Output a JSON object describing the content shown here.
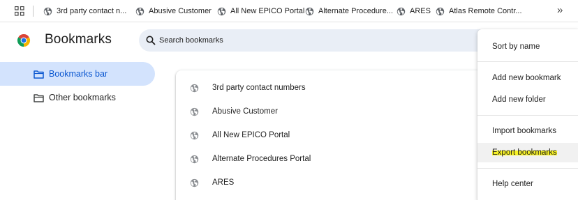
{
  "bookmarks_bar": {
    "items": [
      {
        "label": "3rd party contact n...",
        "icon": "globe-icon"
      },
      {
        "label": "Abusive Customer",
        "icon": "globe-icon"
      },
      {
        "label": "All New EPICO Portal",
        "icon": "globe-icon"
      },
      {
        "label": "Alternate Procedure...",
        "icon": "globe-icon"
      },
      {
        "label": "ARES",
        "icon": "globe-icon"
      },
      {
        "label": "Atlas Remote Contr...",
        "icon": "globe-icon"
      }
    ],
    "overflow_glyph": "»"
  },
  "header": {
    "title": "Bookmarks",
    "search_placeholder": "Search bookmarks"
  },
  "sidebar": {
    "items": [
      {
        "label": "Bookmarks bar",
        "active": true
      },
      {
        "label": "Other bookmarks",
        "active": false
      }
    ]
  },
  "list": {
    "rows": [
      {
        "title": "3rd party contact numbers",
        "icon": "globe-icon"
      },
      {
        "title": "Abusive Customer",
        "icon": "globe-icon"
      },
      {
        "title": "All New EPICO Portal",
        "icon": "globe-icon"
      },
      {
        "title": "Alternate Procedures Portal",
        "icon": "globe-icon"
      },
      {
        "title": "ARES",
        "icon": "globe-icon"
      }
    ]
  },
  "menu": {
    "items": [
      {
        "label": "Sort by name"
      },
      {
        "label": "Add new bookmark"
      },
      {
        "label": "Add new folder"
      },
      {
        "label": "Import bookmarks"
      },
      {
        "label": "Export bookmarks",
        "highlighted": true
      },
      {
        "label": "Help center"
      }
    ]
  },
  "colors": {
    "accent": "#0b57d0",
    "active_bg": "#d3e3fd",
    "search_bg": "#e9eef6",
    "highlighter": "#f7f226"
  }
}
